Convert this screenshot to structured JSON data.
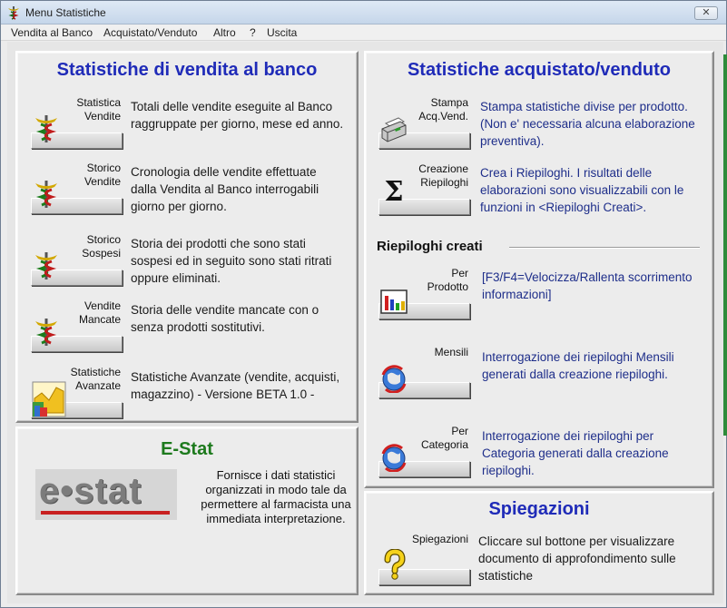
{
  "window": {
    "title": "Menu Statistiche",
    "close_label": "✕"
  },
  "menubar": [
    "Vendita al Banco",
    "Acquistato/Venduto",
    "Altro",
    "?",
    "Uscita"
  ],
  "left_panel": {
    "title": "Statistiche di vendita al banco",
    "rows": [
      {
        "button": [
          "Statistica",
          "Vendite"
        ],
        "icon": "caduceus-icon",
        "description": "Totali delle vendite eseguite al Banco raggruppate per giorno, mese ed anno."
      },
      {
        "button": [
          "Storico",
          "Vendite"
        ],
        "icon": "caduceus-icon",
        "description": "Cronologia delle vendite effettuate dalla Vendita al Banco interrogabili giorno per giorno."
      },
      {
        "button": [
          "Storico",
          "Sospesi"
        ],
        "icon": "caduceus-icon",
        "description": "Storia dei prodotti che sono stati sospesi ed in seguito sono stati ritrati oppure eliminati."
      },
      {
        "button": [
          "Vendite",
          "Mancate"
        ],
        "icon": "caduceus-icon",
        "description": "Storia delle vendite mancate con o senza prodotti sostitutivi."
      },
      {
        "button": [
          "Statistiche",
          "Avanzate"
        ],
        "icon": "chart-3d-icon",
        "description": "Statistiche Avanzate (vendite, acquisti, magazzino) - Versione BETA 1.0 -"
      }
    ]
  },
  "estat_panel": {
    "title": "E-Stat",
    "logo_text": "e•stat",
    "description": "Fornisce i dati statistici organizzati in modo tale da permettere al farmacista una immediata interpretazione."
  },
  "right_panel": {
    "title": "Statistiche acquistato/venduto",
    "rows": [
      {
        "button": [
          "Stampa",
          "Acq.Vend."
        ],
        "icon": "printer-icon",
        "description": "Stampa statistiche divise per prodotto. (Non e' necessaria alcuna elaborazione preventiva)."
      },
      {
        "button": [
          "Creazione",
          "Riepiloghi"
        ],
        "icon": "sigma-icon",
        "description": "Crea i Riepiloghi. I risultati delle elaborazioni sono visualizzabili con le funzioni in <Riepiloghi Creati>."
      }
    ],
    "subsection": "Riepiloghi creati",
    "sub_rows": [
      {
        "button": [
          "Per",
          "Prodotto"
        ],
        "icon": "bar-chart-icon",
        "description": "[F3/F4=Velocizza/Rallenta scorrimento informazioni]"
      },
      {
        "button": [
          "Mensili"
        ],
        "icon": "refresh-globe-icon",
        "description": "Interrogazione dei riepiloghi Mensili generati dalla creazione riepiloghi."
      },
      {
        "button": [
          "Per",
          "Categoria"
        ],
        "icon": "refresh-globe-icon",
        "description": "Interrogazione dei riepiloghi per Categoria generati dalla creazione riepiloghi."
      }
    ]
  },
  "explain_panel": {
    "title": "Spiegazioni",
    "button": [
      "Spiegazioni"
    ],
    "icon": "question-icon",
    "description": "Cliccare sul bottone per visualizzare documento di approfondimento sulle statistiche"
  }
}
